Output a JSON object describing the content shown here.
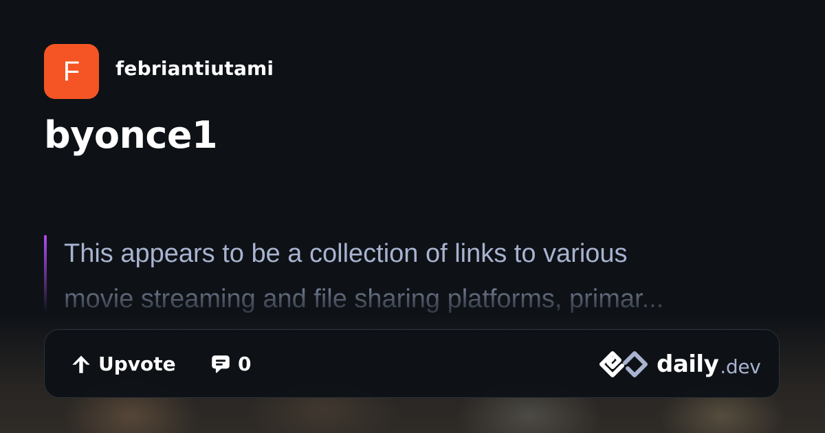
{
  "post": {
    "author": {
      "avatar_letter": "F",
      "name": "febriantiutami",
      "avatar_color": "#f55524"
    },
    "title": "byonce1",
    "summary": {
      "line_1": "This appears to be a collection of links to various",
      "line_2": "movie streaming and file sharing platforms, primar..."
    },
    "actions": {
      "upvote_label": "Upvote",
      "comment_count": "0"
    },
    "brand": {
      "name": "daily",
      "suffix": ".dev"
    }
  },
  "colors": {
    "background": "#0e1217",
    "summary_text": "#a8b3cf",
    "accent_bar": "#b14cf0",
    "card_border": "#2d323b"
  },
  "icons": {
    "upvote": "arrow-up-icon",
    "comment": "comment-bubble-icon",
    "brand": "daily-dev-logo-icon"
  }
}
